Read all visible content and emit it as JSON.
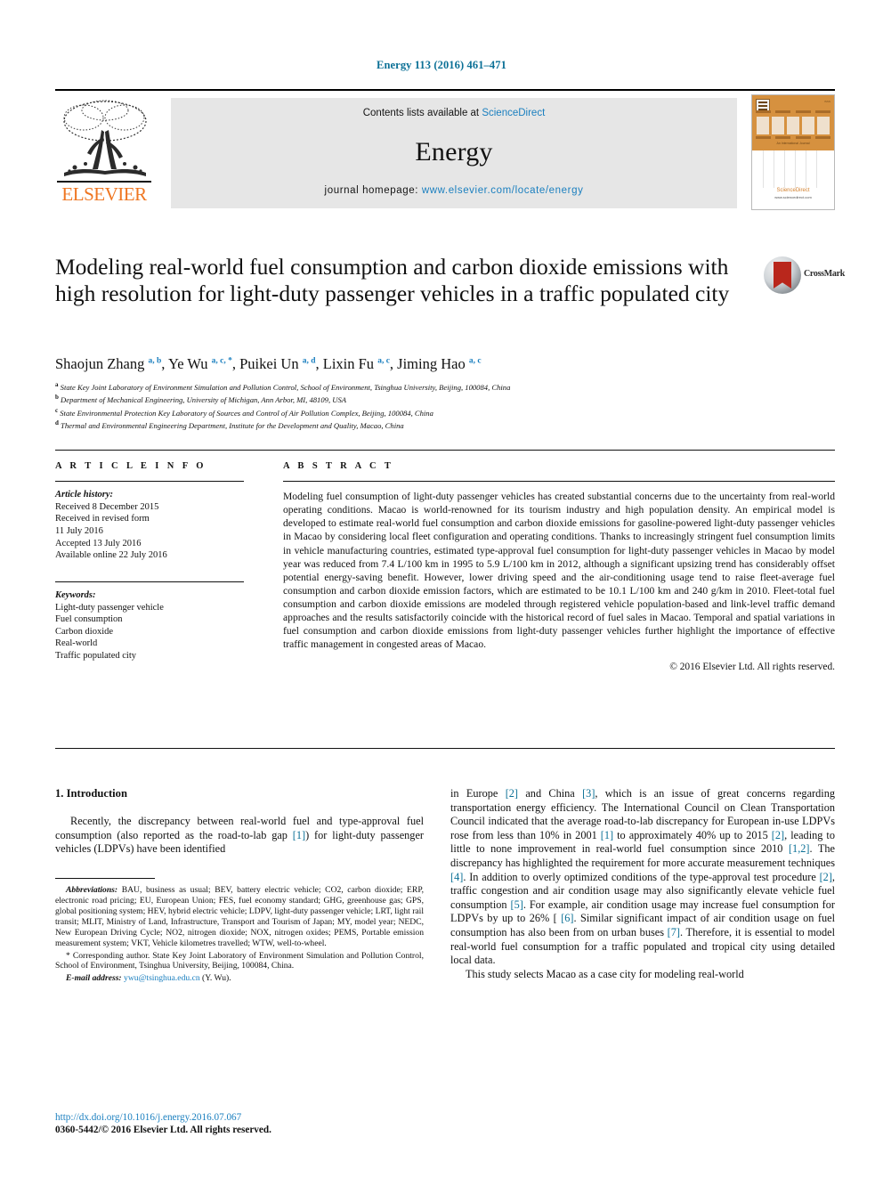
{
  "running_head": "Energy 113 (2016) 461–471",
  "masthead": {
    "publisher": "ELSEVIER",
    "contents_prefix": "Contents lists available at ",
    "contents_link": "ScienceDirect",
    "journal_title": "Energy",
    "homepage_prefix": "journal homepage: ",
    "homepage_url": "www.elsevier.com/locate/energy",
    "cover_word": "ENERGY",
    "cover_sub": "An International Journal",
    "cover_foot": "ScienceDirect",
    "cover_foot_url": "www.sciencedirect.com"
  },
  "article": {
    "title": "Modeling real-world fuel consumption and carbon dioxide emissions with high resolution for light-duty passenger vehicles in a traffic populated city",
    "crossmark_label": "CrossMark",
    "authors": [
      {
        "name": "Shaojun Zhang",
        "sup": "a, b",
        "sep": ", "
      },
      {
        "name": "Ye Wu",
        "sup": "a, c, *",
        "sep": ", "
      },
      {
        "name": "Puikei Un",
        "sup": "a, d",
        "sep": ", "
      },
      {
        "name": "Lixin Fu",
        "sup": "a, c",
        "sep": ", "
      },
      {
        "name": "Jiming Hao",
        "sup": "a, c",
        "sep": ""
      }
    ],
    "affiliations": [
      {
        "mark": "a",
        "text": "State Key Joint Laboratory of Environment Simulation and Pollution Control, School of Environment, Tsinghua University, Beijing, 100084, China"
      },
      {
        "mark": "b",
        "text": "Department of Mechanical Engineering, University of Michigan, Ann Arbor, MI, 48109, USA"
      },
      {
        "mark": "c",
        "text": "State Environmental Protection Key Laboratory of Sources and Control of Air Pollution Complex, Beijing, 100084, China"
      },
      {
        "mark": "d",
        "text": "Thermal and Environmental Engineering Department, Institute for the Development and Quality, Macao, China"
      }
    ]
  },
  "article_info": {
    "heading": "A R T I C L E  I N F O",
    "history_label": "Article history:",
    "history": [
      "Received 8 December 2015",
      "Received in revised form",
      "11 July 2016",
      "Accepted 13 July 2016",
      "Available online 22 July 2016"
    ],
    "keywords_label": "Keywords:",
    "keywords": [
      "Light-duty passenger vehicle",
      "Fuel consumption",
      "Carbon dioxide",
      "Real-world",
      "Traffic populated city"
    ]
  },
  "abstract": {
    "heading": "A B S T R A C T",
    "text": "Modeling fuel consumption of light-duty passenger vehicles has created substantial concerns due to the uncertainty from real-world operating conditions. Macao is world-renowned for its tourism industry and high population density. An empirical model is developed to estimate real-world fuel consumption and carbon dioxide emissions for gasoline-powered light-duty passenger vehicles in Macao by considering local fleet configuration and operating conditions. Thanks to increasingly stringent fuel consumption limits in vehicle manufacturing countries, estimated type-approval fuel consumption for light-duty passenger vehicles in Macao by model year was reduced from 7.4 L/100 km in 1995 to 5.9 L/100 km in 2012, although a significant upsizing trend has considerably offset potential energy-saving benefit. However, lower driving speed and the air-conditioning usage tend to raise fleet-average fuel consumption and carbon dioxide emission factors, which are estimated to be 10.1 L/100 km and 240 g/km in 2010. Fleet-total fuel consumption and carbon dioxide emissions are modeled through registered vehicle population-based and link-level traffic demand approaches and the results satisfactorily coincide with the historical record of fuel sales in Macao. Temporal and spatial variations in fuel consumption and carbon dioxide emissions from light-duty passenger vehicles further highlight the importance of effective traffic management in congested areas of Macao.",
    "copyright": "© 2016 Elsevier Ltd. All rights reserved."
  },
  "introduction": {
    "heading": "1. Introduction",
    "left_para_1_a": "Recently, the discrepancy between real-world fuel and type-approval fuel consumption (also reported as the road-to-lab gap ",
    "left_ref_1": "[1]",
    "left_para_1_b": ") for light-duty passenger vehicles (LDPVs) have been identified"
  },
  "right_column": {
    "p1_s1": "in Europe ",
    "r2": "[2]",
    "p1_s2": " and China ",
    "r3": "[3]",
    "p1_s3": ", which is an issue of great concerns regarding transportation energy efficiency. The International Council on Clean Transportation Council indicated that the average road-to-lab discrepancy for European in-use LDPVs rose from less than 10% in 2001 ",
    "r1": "[1]",
    "p1_s4": " to approximately 40% up to 2015 ",
    "r2b": "[2]",
    "p1_s5": ", leading to little to none improvement in real-world fuel consumption since 2010 ",
    "r12": "[1,2]",
    "p1_s6": ". The discrepancy has highlighted the requirement for more accurate measurement techniques ",
    "r4": "[4]",
    "p1_s7": ". In addition to overly optimized conditions of the type-approval test procedure ",
    "r2c": "[2]",
    "p1_s8": ", traffic congestion and air condition usage may also significantly elevate vehicle fuel consumption ",
    "r5": "[5]",
    "p1_s9": ". For example, air condition usage may increase fuel consumption for LDPVs by up to 26% [ ",
    "r6": "[6]",
    "p1_s10": ". Similar significant impact of air condition usage on fuel consumption has also been from on urban buses ",
    "r7": "[7]",
    "p1_s11": ". Therefore, it is essential to model real-world fuel consumption for a traffic populated and tropical city using detailed local data.",
    "p2": "This study selects Macao as a case city for modeling real-world"
  },
  "footnotes": {
    "abbrev_label": "Abbreviations:",
    "abbrev_text": " BAU, business as usual; BEV, battery electric vehicle; CO2, carbon dioxide; ERP, electronic road pricing; EU, European Union; FES, fuel economy standard; GHG, greenhouse gas; GPS, global positioning system; HEV, hybrid electric vehicle; LDPV, light-duty passenger vehicle; LRT, light rail transit; MLIT, Ministry of Land, Infrastructure, Transport and Tourism of Japan; MY, model year; NEDC, New European Driving Cycle; NO2, nitrogen dioxide; NOX, nitrogen oxides; PEMS, Portable emission measurement system; VKT, Vehicle kilometres travelled; WTW, well-to-wheel.",
    "corresponding": "* Corresponding author. State Key Joint Laboratory of Environment Simulation and Pollution Control, School of Environment, Tsinghua University, Beijing, 100084, China.",
    "email_label": "E-mail address:",
    "email": "ywu@tsinghua.edu.cn",
    "email_suffix": " (Y. Wu)."
  },
  "footer": {
    "doi": "http://dx.doi.org/10.1016/j.energy.2016.07.067",
    "issn": "0360-5442/© 2016 Elsevier Ltd. All rights reserved."
  },
  "colors": {
    "link": "#1a7fbf",
    "runhead": "#0b7096",
    "elsevier_orange": "#ef7622",
    "banner_gray": "#e6e6e6",
    "crossmark_red": "#b9271c"
  }
}
